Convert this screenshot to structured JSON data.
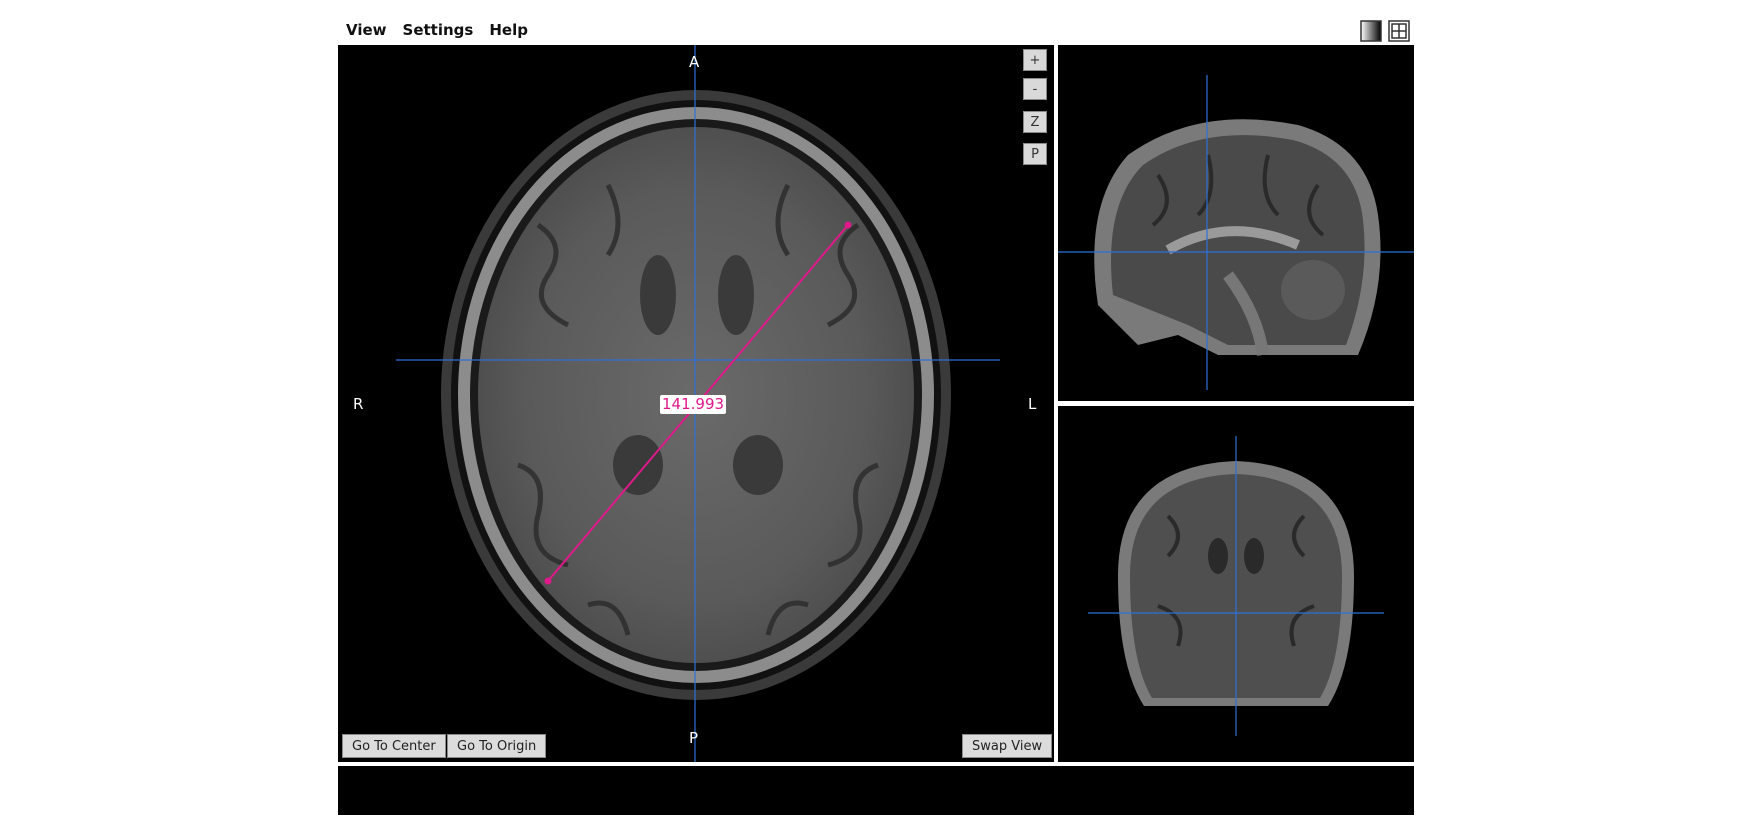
{
  "menu": {
    "items": [
      "View",
      "Settings",
      "Help"
    ]
  },
  "toolbar": {
    "icons": [
      "colormap-icon",
      "fullscreen-icon"
    ]
  },
  "axial": {
    "orientation": {
      "top": "A",
      "bottom": "P",
      "left": "R",
      "right": "L"
    },
    "controls": {
      "zoom_in": "+",
      "zoom_out": "-",
      "zoom_reset": "Z",
      "pan": "P"
    },
    "measurement": {
      "value": "141.993",
      "color": "#e0198a"
    },
    "buttons": {
      "go_to_center": "Go To Center",
      "go_to_origin": "Go To Origin",
      "swap_view": "Swap View"
    }
  },
  "colors": {
    "crosshair": "#2f6fd6",
    "measure": "#e0198a",
    "background": "#000000"
  }
}
